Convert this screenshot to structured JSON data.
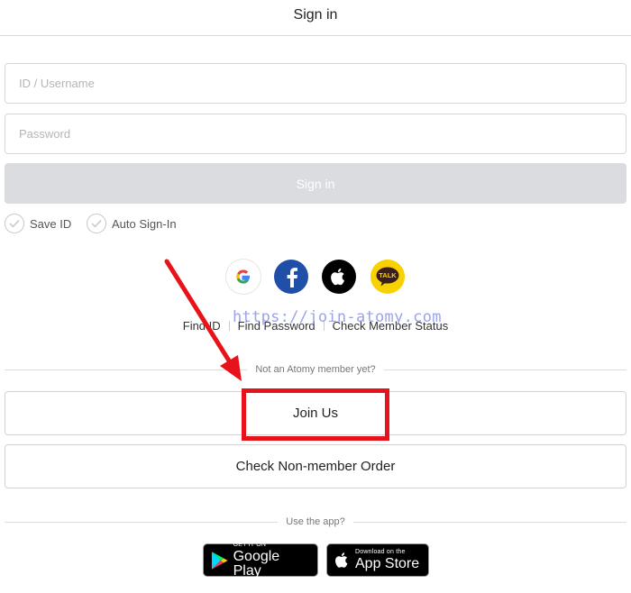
{
  "header": {
    "title": "Sign in"
  },
  "form": {
    "id_placeholder": "ID / Username",
    "id_value": "",
    "password_placeholder": "Password",
    "password_value": "",
    "signin_label": "Sign in"
  },
  "options": {
    "save_id_label": "Save ID",
    "auto_signin_label": "Auto Sign-In"
  },
  "social": {
    "icons": [
      "google-icon",
      "facebook-icon",
      "apple-icon",
      "kakaotalk-icon"
    ],
    "kakao_text": "TALK",
    "colors": {
      "facebook": "#1f4fa8",
      "apple": "#000000",
      "kakao": "#f7d200"
    }
  },
  "links": {
    "find_id": "Find ID",
    "find_password": "Find Password",
    "check_member_status": "Check Member Status"
  },
  "watermark": "https://join-atomy.com",
  "member_section": {
    "divider_text": "Not an Atomy member yet?",
    "join_label": "Join Us",
    "nonmember_order_label": "Check Non-member Order"
  },
  "app_section": {
    "divider_text": "Use the app?",
    "google_play": {
      "small": "GET IT ON",
      "big": "Google Play"
    },
    "app_store": {
      "small": "Download on the",
      "big": "App Store"
    }
  },
  "annotation": {
    "color": "#e8131a"
  }
}
